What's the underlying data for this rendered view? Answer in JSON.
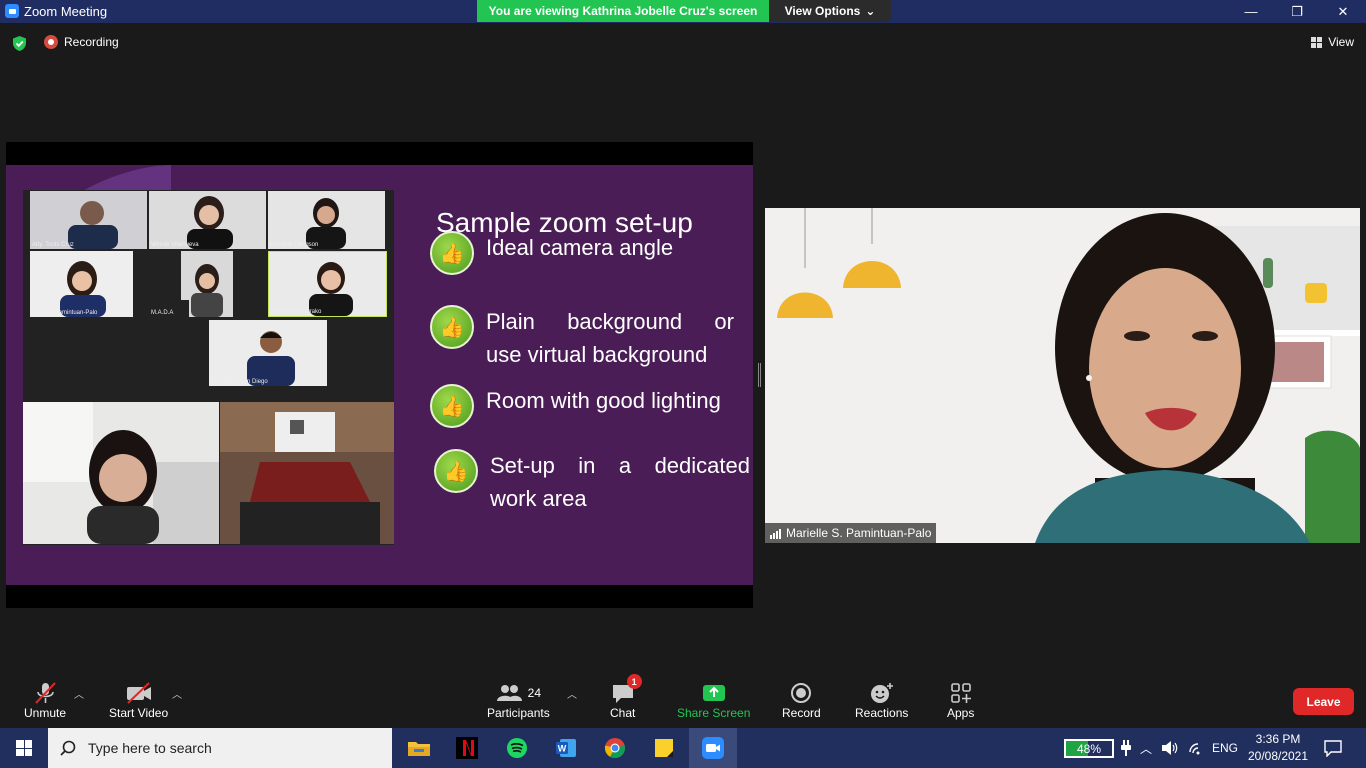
{
  "window": {
    "title": "Zoom Meeting"
  },
  "share_banner": {
    "text": "You are viewing Kathrina Jobelle Cruz's screen",
    "view_options": "View Options"
  },
  "topbar": {
    "recording": "Recording",
    "view": "View"
  },
  "slide": {
    "title": "Sample zoom set-up",
    "bullets": [
      {
        "line1": "Ideal camera angle",
        "line2": ""
      },
      {
        "line1": "Plain background or",
        "line2": "use virtual background"
      },
      {
        "line1": "Room with good lighting",
        "line2": ""
      },
      {
        "line1": "Set-up in a dedicated",
        "line2": "work area"
      }
    ],
    "gallery_names": [
      "Atty. Toots Cruz",
      "Winnie Villanueva",
      "Eumarie Tiongson",
      "Marielle Pamintuan-Palo",
      "M.A.D.A",
      "Anne Lissa Dyrako",
      "Ferdinand San Diego"
    ]
  },
  "speaker": {
    "name": "Marielle S. Pamintuan-Palo"
  },
  "toolbar": {
    "unmute": "Unmute",
    "start_video": "Start Video",
    "participants": "Participants",
    "participants_count": "24",
    "chat": "Chat",
    "chat_badge": "1",
    "share_screen": "Share Screen",
    "record": "Record",
    "reactions": "Reactions",
    "apps": "Apps",
    "leave": "Leave"
  },
  "taskbar": {
    "search_placeholder": "Type here to search",
    "battery": "48%",
    "battery_level": 0.48,
    "language": "ENG",
    "time": "3:36 PM",
    "date": "20/08/2021"
  },
  "colors": {
    "share_green": "#23c552",
    "leave_red": "#e02828",
    "titlebar": "#1f2d63",
    "slide_purple": "#4b1d56"
  }
}
